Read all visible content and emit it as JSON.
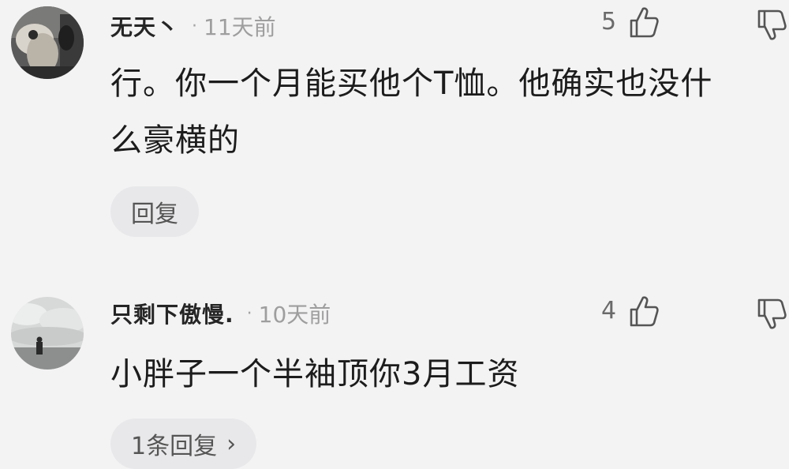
{
  "comments": [
    {
      "username": "无天丶",
      "separator": "·",
      "time": "11天前",
      "likes": "5",
      "text_lines": [
        "行。你一个月能买他个T恤。他确实也没什",
        "么豪横的"
      ],
      "reply_label": "回复",
      "avatar_icon": "photo-avatar-icon"
    },
    {
      "username": "只剩下傲慢.",
      "separator": "·",
      "time": "10天前",
      "likes": "4",
      "text_lines": [
        "小胖子一个半袖顶你3月工资"
      ],
      "reply_label": "1条回复",
      "reply_chevron": "›",
      "avatar_icon": "photo-avatar-icon"
    }
  ],
  "icons": {
    "like": "thumbs-up-icon",
    "dislike": "thumbs-down-icon"
  },
  "colors": {
    "background": "#f4f3f4",
    "pill": "#e8e8ea",
    "text": "#1c1c1c",
    "muted": "#9e9e9e"
  }
}
